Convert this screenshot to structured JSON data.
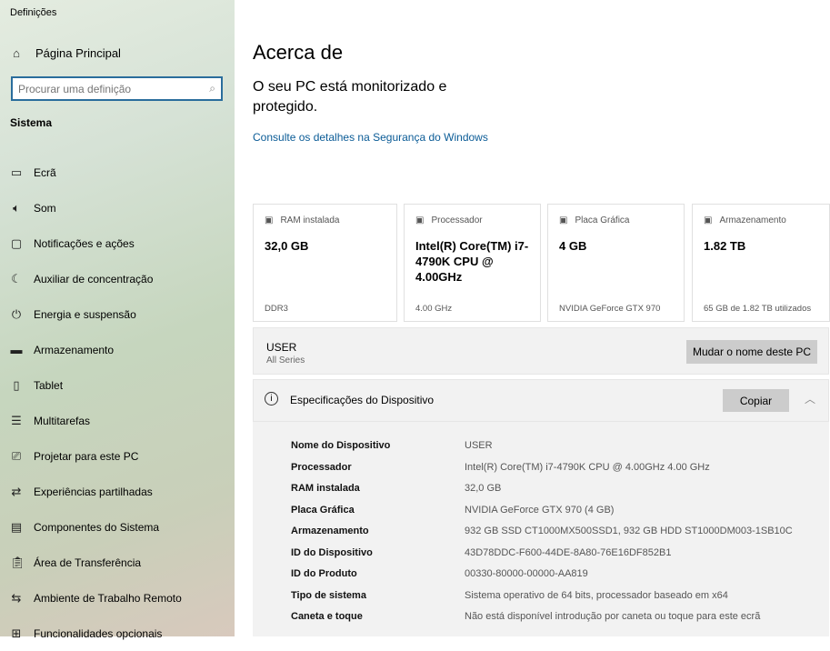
{
  "app_title": "Definições",
  "sidebar": {
    "home": "Página Principal",
    "search_placeholder": "Procurar uma definição",
    "section": "Sistema",
    "items": [
      {
        "label": "Ecrã",
        "icon": "monitor-icon"
      },
      {
        "label": "Som",
        "icon": "speaker-icon"
      },
      {
        "label": "Notificações e ações",
        "icon": "notification-icon"
      },
      {
        "label": "Auxiliar de concentração",
        "icon": "moon-icon"
      },
      {
        "label": "Energia e suspensão",
        "icon": "power-icon"
      },
      {
        "label": "Armazenamento",
        "icon": "storage-icon"
      },
      {
        "label": "Tablet",
        "icon": "tablet-icon"
      },
      {
        "label": "Multitarefas",
        "icon": "multitask-icon"
      },
      {
        "label": "Projetar para este PC",
        "icon": "project-icon"
      },
      {
        "label": "Experiências partilhadas",
        "icon": "share-icon"
      },
      {
        "label": "Componentes do Sistema",
        "icon": "components-icon"
      },
      {
        "label": "Área de Transferência",
        "icon": "clipboard-icon"
      },
      {
        "label": "Ambiente de Trabalho Remoto",
        "icon": "remote-icon"
      },
      {
        "label": "Funcionalidades opcionais",
        "icon": "optional-icon"
      }
    ]
  },
  "main": {
    "title": "Acerca de",
    "protection": "O seu PC está monitorizado e protegido.",
    "security_link": "Consulte os detalhes na Segurança do Windows",
    "cards": [
      {
        "label": "RAM instalada",
        "value": "32,0 GB",
        "sub": "DDR3"
      },
      {
        "label": "Processador",
        "value": "Intel(R) Core(TM) i7-4790K CPU @ 4.00GHz",
        "sub": "4.00 GHz"
      },
      {
        "label": "Placa Gráfica",
        "value": "4 GB",
        "sub": "NVIDIA GeForce GTX 970"
      },
      {
        "label": "Armazenamento",
        "value": "1.82 TB",
        "sub": "65 GB de 1.82 TB utilizados"
      }
    ],
    "pc_name": "USER",
    "pc_model": "All Series",
    "rename_button": "Mudar o nome deste PC",
    "specs_title": "Especificações do Dispositivo",
    "copy_button": "Copiar",
    "specs": [
      {
        "k": "Nome do Dispositivo",
        "v": "USER"
      },
      {
        "k": "Processador",
        "v": "Intel(R) Core(TM) i7-4790K CPU @ 4.00GHz   4.00 GHz"
      },
      {
        "k": "RAM instalada",
        "v": "32,0 GB"
      },
      {
        "k": "Placa Gráfica",
        "v": "NVIDIA GeForce GTX 970 (4 GB)"
      },
      {
        "k": "Armazenamento",
        "v": "932 GB SSD CT1000MX500SSD1, 932 GB HDD ST1000DM003-1SB10C"
      },
      {
        "k": "ID do Dispositivo",
        "v": "43D78DDC-F600-44DE-8A80-76E16DF852B1"
      },
      {
        "k": "ID do Produto",
        "v": "00330-80000-00000-AA819"
      },
      {
        "k": "Tipo de sistema",
        "v": "Sistema operativo de 64 bits, processador baseado em x64"
      },
      {
        "k": "Caneta e toque",
        "v": "Não está disponível introdução por caneta ou toque para este ecrã"
      }
    ]
  }
}
